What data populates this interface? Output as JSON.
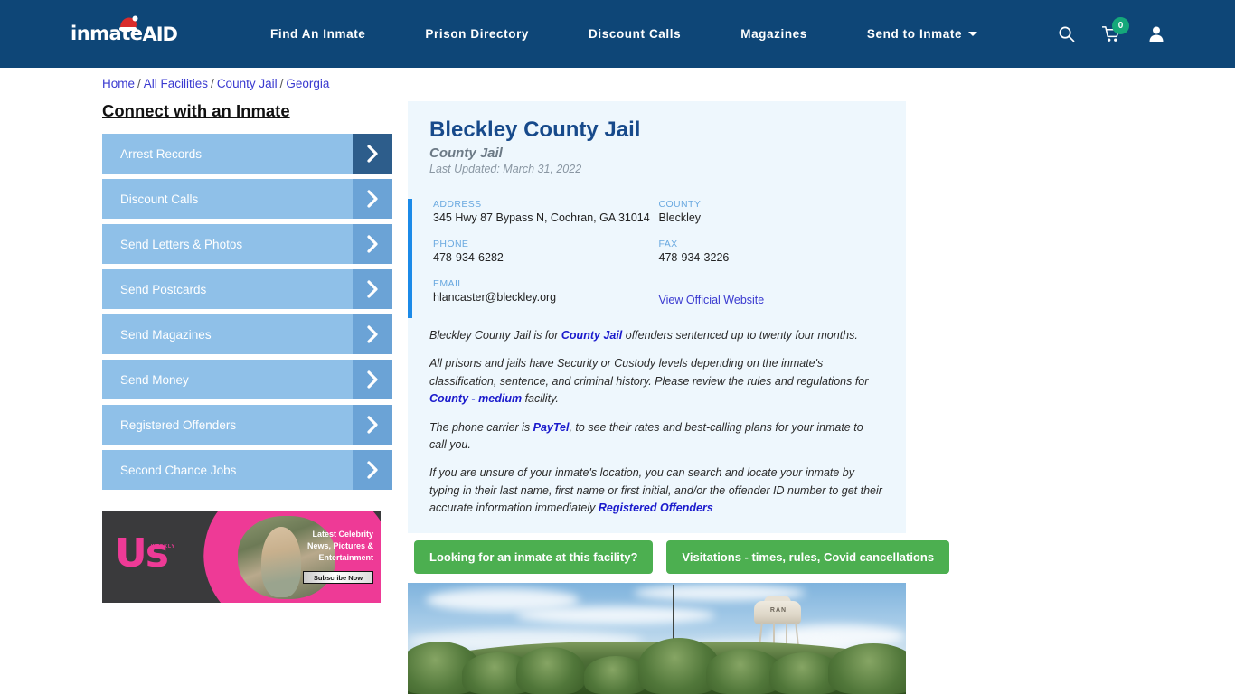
{
  "header": {
    "logo_text": "inmate",
    "logo_text_accent": "AID",
    "nav_items": [
      {
        "label": "Find An Inmate"
      },
      {
        "label": "Prison Directory"
      },
      {
        "label": "Discount Calls"
      },
      {
        "label": "Magazines"
      }
    ],
    "dropdown_label": "Send to Inmate",
    "cart_count": "0",
    "icons": {
      "search": "search-icon",
      "cart": "cart-icon",
      "account": "user-icon"
    },
    "bg_color": "#0e4677",
    "badge_color": "#15a87a"
  },
  "breadcrumb": {
    "items": [
      {
        "label": "Home"
      },
      {
        "label": "All Facilities"
      },
      {
        "label": "County Jail"
      },
      {
        "label": "Georgia"
      }
    ],
    "separator": "/"
  },
  "sidebar": {
    "title": "Connect with an Inmate",
    "items": [
      {
        "label": "Arrest Records",
        "active": true
      },
      {
        "label": "Discount Calls",
        "active": false
      },
      {
        "label": "Send Letters & Photos",
        "active": false
      },
      {
        "label": "Send Postcards",
        "active": false
      },
      {
        "label": "Send Magazines",
        "active": false
      },
      {
        "label": "Send Money",
        "active": false
      },
      {
        "label": "Registered Offenders",
        "active": false
      },
      {
        "label": "Second Chance Jobs",
        "active": false
      }
    ],
    "button_color": "#8fc0e8",
    "arrow_color": "#6ba3d6",
    "arrow_active_color": "#2d5d8b"
  },
  "ad": {
    "brand": "Us",
    "brand_sub": "WEEKLY",
    "copy": "Latest Celebrity News, Pictures & Entertainment",
    "cta": "Subscribe Now",
    "accent_color": "#ee3a96"
  },
  "facility": {
    "name": "Bleckley County Jail",
    "type": "County Jail",
    "last_updated": "Last Updated: March 31, 2022",
    "contact": {
      "address_label": "ADDRESS",
      "address_value": "345 Hwy 87 Bypass N, Cochran, GA 31014",
      "county_label": "COUNTY",
      "county_value": "Bleckley",
      "phone_label": "PHONE",
      "phone_value": "478-934-6282",
      "fax_label": "FAX",
      "fax_value": "478-934-3226",
      "email_label": "EMAIL",
      "email_value": "hlancaster@bleckley.org",
      "website_link": "View Official Website"
    },
    "accent_bar_color": "#1b8ae8",
    "panel_bg": "#eef7fd"
  },
  "description": {
    "p1_a": "Bleckley County Jail is for ",
    "p1_link": "County Jail",
    "p1_b": " offenders sentenced up to twenty four months.",
    "p2_a": "All prisons and jails have Security or Custody levels depending on the inmate's classification, sentence, and criminal history. Please review the rules and regulations for ",
    "p2_link": "County - medium",
    "p2_b": " facility.",
    "p3_a": "The phone carrier is ",
    "p3_link": "PayTel",
    "p3_b": ", to see their rates and best-calling plans for your inmate to call you.",
    "p4_a": "If you are unsure of your inmate's location, you can search and locate your inmate by typing in their last name, first name or first initial, and/or the offender ID number to get their accurate information immediately ",
    "p4_link": "Registered Offenders"
  },
  "ctas": {
    "inmate_search": "Looking for an inmate at this facility?",
    "visitations": "Visitations - times, rules, Covid cancellations",
    "color": "#4caf50"
  },
  "photo": {
    "tower_label": "RAN",
    "alt": "street-view photo of facility area with water tower"
  }
}
